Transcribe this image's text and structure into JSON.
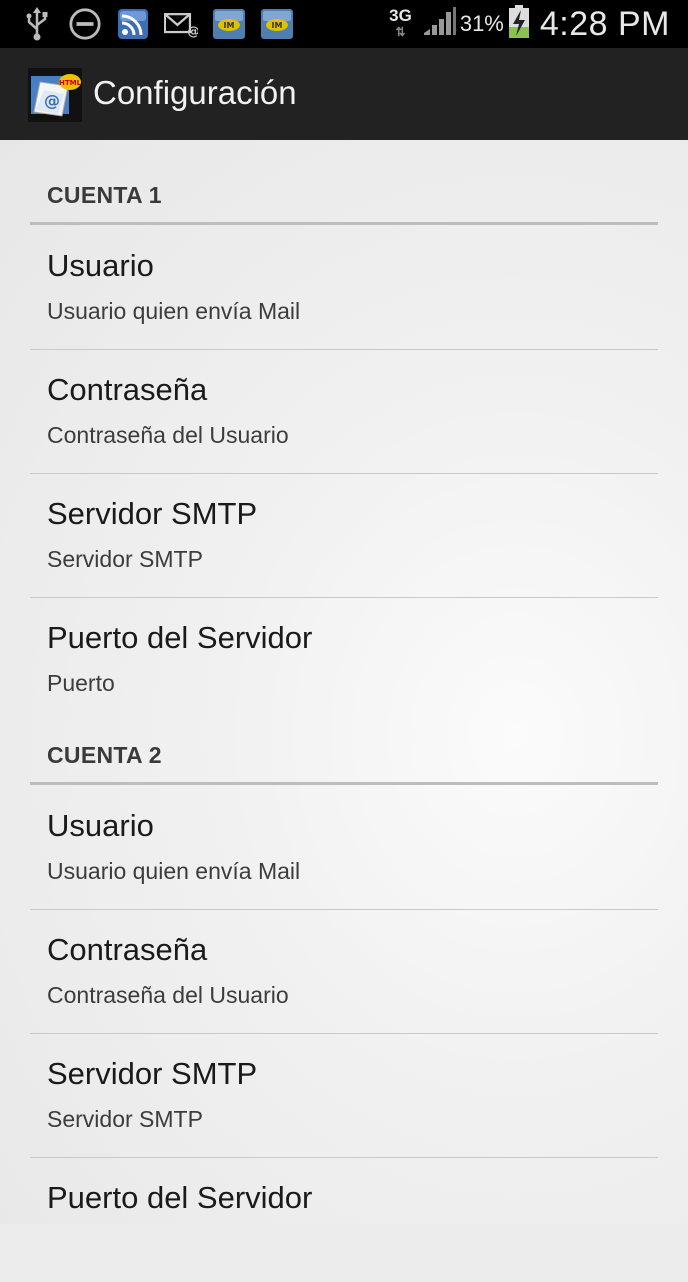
{
  "status_bar": {
    "icons_left": [
      "usb-icon",
      "do-not-disturb-icon",
      "rss-icon",
      "mail-icon",
      "bbm-icon",
      "bbm-icon"
    ],
    "network": "3G",
    "battery_percent": "31%",
    "time": "4:28 PM"
  },
  "action_bar": {
    "title": "Configuración"
  },
  "colors": {
    "status_bar_bg": "#000000",
    "action_bar_bg": "#222222",
    "content_bg": "#ececec",
    "battery_fill": "#8bc34a"
  },
  "sections": [
    {
      "title": "CUENTA 1",
      "items": [
        {
          "title": "Usuario",
          "summary": "Usuario quien envía Mail"
        },
        {
          "title": "Contraseña",
          "summary": "Contraseña del Usuario"
        },
        {
          "title": "Servidor SMTP",
          "summary": "Servidor SMTP"
        },
        {
          "title": "Puerto del Servidor",
          "summary": "Puerto"
        }
      ]
    },
    {
      "title": "CUENTA 2",
      "items": [
        {
          "title": "Usuario",
          "summary": "Usuario quien envía Mail"
        },
        {
          "title": "Contraseña",
          "summary": "Contraseña del Usuario"
        },
        {
          "title": "Servidor SMTP",
          "summary": "Servidor SMTP"
        },
        {
          "title": "Puerto del Servidor",
          "summary": ""
        }
      ]
    }
  ]
}
